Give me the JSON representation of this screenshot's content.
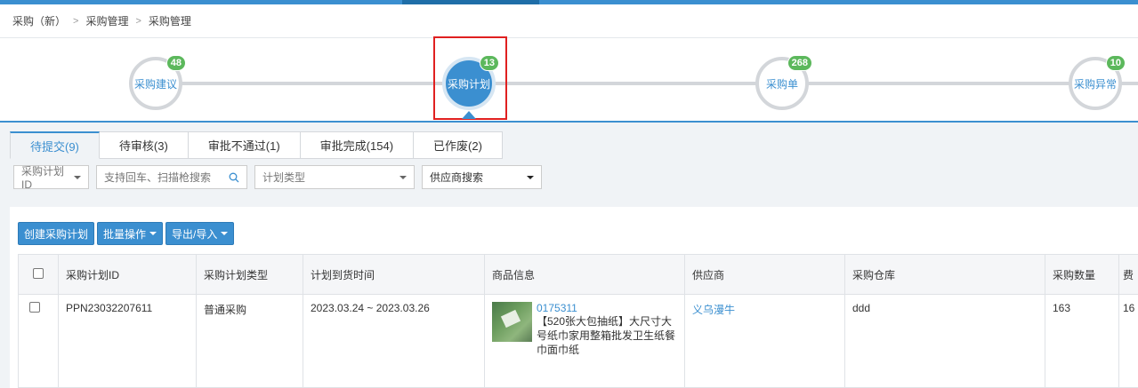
{
  "breadcrumb": {
    "items": [
      "采购（新）",
      "采购管理",
      "采购管理"
    ]
  },
  "flow": {
    "steps": [
      {
        "label": "采购建议",
        "count": "48"
      },
      {
        "label": "采购计划",
        "count": "13"
      },
      {
        "label": "采购单",
        "count": "268"
      },
      {
        "label": "采购异常",
        "count": "10"
      }
    ]
  },
  "tabs": [
    "待提交(9)",
    "待审核(3)",
    "审批不通过(1)",
    "审批完成(154)",
    "已作废(2)"
  ],
  "filters": {
    "id_select": "采购计划ID",
    "search_placeholder": "支持回车、扫描枪搜索",
    "type_placeholder": "计划类型",
    "supplier_select": "供应商搜索"
  },
  "toolbar": {
    "create": "创建采购计划",
    "batch": "批量操作",
    "export": "导出/导入"
  },
  "table": {
    "columns": [
      "采购计划ID",
      "采购计划类型",
      "计划到货时间",
      "商品信息",
      "供应商",
      "采购仓库",
      "采购数量",
      "费"
    ],
    "rows": [
      {
        "id": "PPN23032207611",
        "type": "普通采购",
        "arrival": "2023.03.24 ~ 2023.03.26",
        "product_code": "0175311",
        "product_title": "【520张大包抽纸】大尺寸大号纸巾家用整箱批发卫生纸餐巾面巾纸",
        "supplier": "义乌漫牛",
        "warehouse": "ddd",
        "quantity": "163",
        "fee": "16"
      }
    ]
  }
}
